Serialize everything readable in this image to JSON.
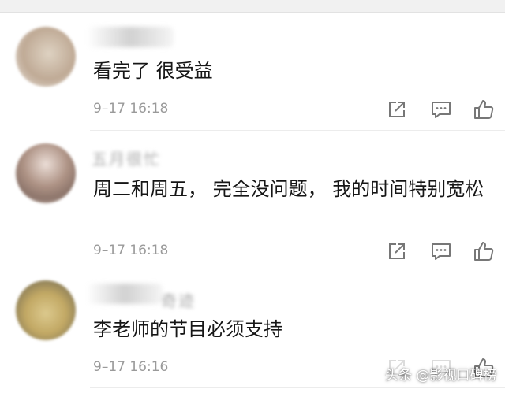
{
  "comments": [
    {
      "username": "",
      "text": "看完了 很受益",
      "time": "9–17 16:18",
      "actions": [
        "share-icon",
        "reply-icon",
        "like-icon"
      ]
    },
    {
      "username": "五月很忙",
      "text": "周二和周五， 完全没问题， 我的时间特别宽松",
      "time": "9–17 16:18",
      "actions": [
        "share-icon",
        "reply-icon",
        "like-icon"
      ]
    },
    {
      "username": "奇迹",
      "text": "李老师的节目必须支持",
      "time": "9–17 16:16",
      "actions": [
        "share-icon",
        "reply-icon",
        "like-icon"
      ]
    }
  ],
  "watermark": "头条 @影视口碑榜",
  "colors": {
    "text": "#161616",
    "meta": "#9a9a9a",
    "icon": "#777777",
    "divider": "#ececec"
  }
}
